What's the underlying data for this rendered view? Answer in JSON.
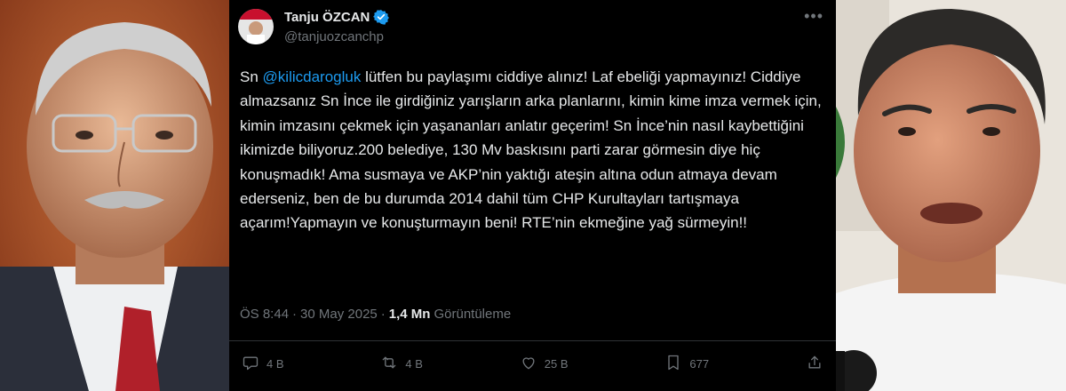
{
  "tweet": {
    "author_name": "Tanju ÖZCAN",
    "handle": "@tanjuozcanchp",
    "text_prefix": "Sn ",
    "mention": "@kilicdarogluk",
    "text_body": " lütfen bu paylaşımı ciddiye alınız! Laf ebeliği yapmayınız! Ciddiye almazsanız Sn İnce ile girdiğiniz yarışların arka planlarını, kimin kime imza vermek için, kimin imzasını çekmek için yaşananları anlatır geçerim! Sn İnce’nin nasıl kaybettiğini ikimizde biliyoruz.200 belediye, 130 Mv baskısını parti zarar görmesin diye hiç konuşmadık! Ama susmaya ve AKP’nin yaktığı ateşin altına odun atmaya devam ederseniz, ben de bu durumda 2014 dahil tüm CHP Kurultayları tartışmaya açarım!Yapmayın ve konuşturmayın beni! RTE’nin ekmeğine yağ sürmeyin!!",
    "time": "ÖS 8:44",
    "dot": "·",
    "date": "30 May 2025",
    "views_count": "1,4 Mn",
    "views_label": "Görüntüleme",
    "actions": {
      "replies": "4 B",
      "reposts": "4 B",
      "likes": "25 B",
      "bookmarks": "677"
    },
    "more_icon": "more-horizontal-icon",
    "verified_color": "#1d9bf0"
  },
  "colors": {
    "background": "#000000",
    "text": "#e7e9ea",
    "muted": "#71767b",
    "accent": "#1d9bf0"
  }
}
